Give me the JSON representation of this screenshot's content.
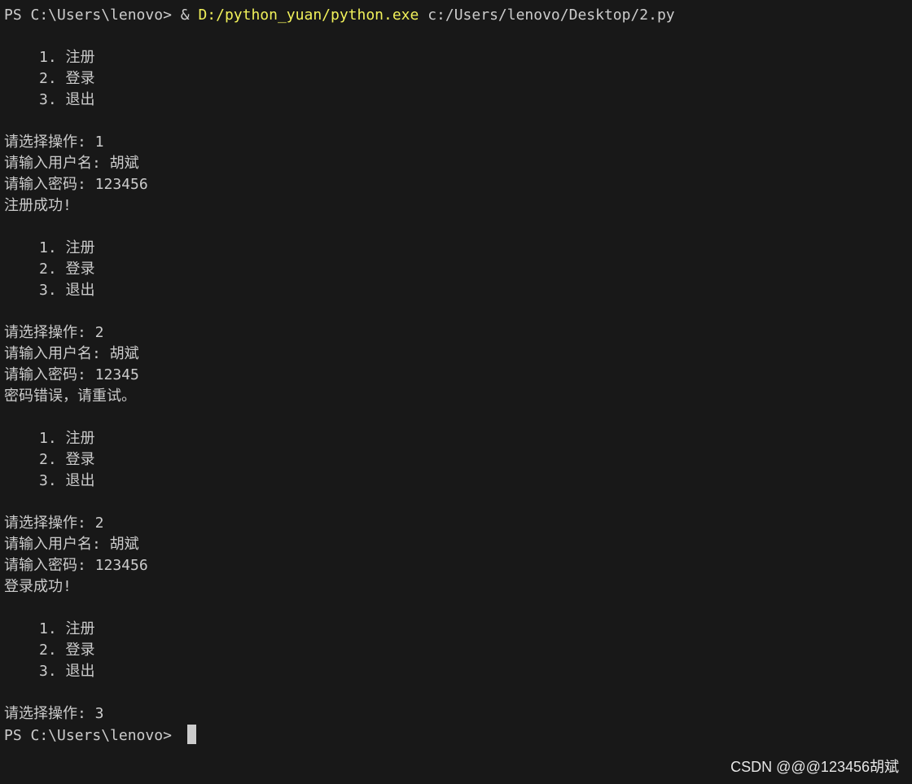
{
  "terminal": {
    "command": {
      "prompt": "PS C:\\Users\\lenovo> ",
      "operator": "& ",
      "exe": "D:/python_yuan/python.exe",
      "arg": " c:/Users/lenovo/Desktop/2.py"
    },
    "menu": {
      "item1": "1. 注册",
      "item2": "2. 登录",
      "item3": "3. 退出"
    },
    "session": [
      {
        "choose": "请选择操作: 1",
        "username": "请输入用户名: 胡斌",
        "password": "请输入密码: 123456",
        "result": "注册成功!"
      },
      {
        "choose": "请选择操作: 2",
        "username": "请输入用户名: 胡斌",
        "password": "请输入密码: 12345",
        "result": "密码错误，请重试。"
      },
      {
        "choose": "请选择操作: 2",
        "username": "请输入用户名: 胡斌",
        "password": "请输入密码: 123456",
        "result": "登录成功!"
      }
    ],
    "final_choose": "请选择操作: 3",
    "final_prompt": "PS C:\\Users\\lenovo> "
  },
  "watermark": "CSDN @@@123456胡斌",
  "colors": {
    "background": "#181818",
    "text": "#cccccc",
    "path_highlight": "#f1f15a"
  }
}
